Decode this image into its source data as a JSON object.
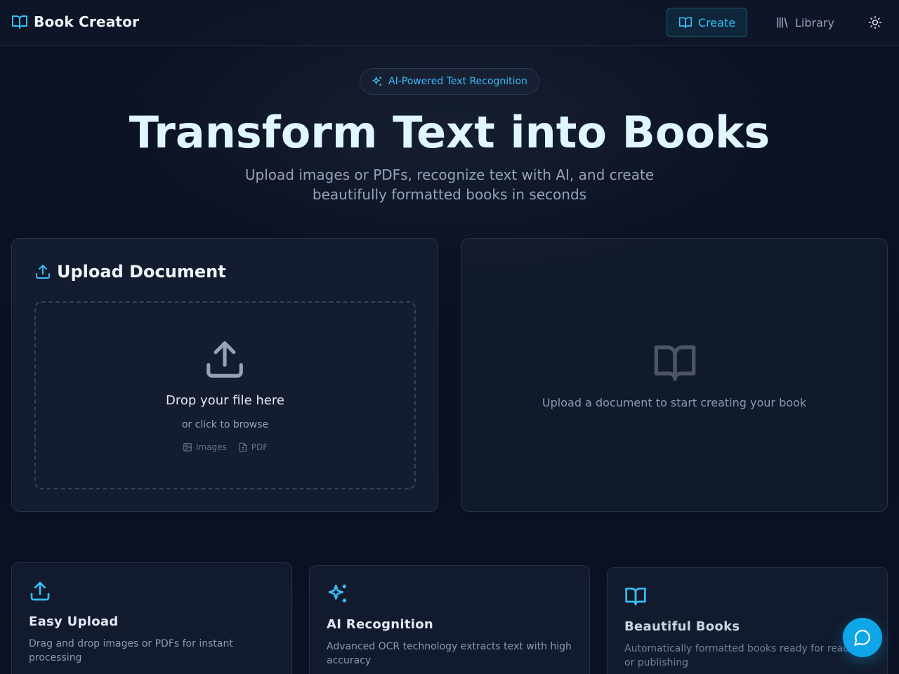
{
  "nav": {
    "brand": "Book Creator",
    "create_label": "Create",
    "library_label": "Library",
    "theme_icon": "sun-icon"
  },
  "hero": {
    "badge": "AI-Powered Text Recognition",
    "title": "Transform Text into Books",
    "subtitle": "Upload images or PDFs, recognize text with AI, and create beautifully formatted books in seconds"
  },
  "upload": {
    "heading": "Upload Document",
    "drop_title": "Drop your file here",
    "drop_sub": "or click to browse",
    "types": [
      "Images",
      "PDF"
    ]
  },
  "preview": {
    "empty_text": "Upload a document to start creating your book"
  },
  "features": [
    {
      "icon": "upload-icon",
      "title": "Easy Upload",
      "desc": "Drag and drop images or PDFs for instant processing"
    },
    {
      "icon": "sparkles-icon",
      "title": "AI Recognition",
      "desc": "Advanced OCR technology extracts text with high accuracy"
    },
    {
      "icon": "book-open-icon",
      "title": "Beautiful Books",
      "desc": "Automatically formatted books ready for reading or publishing"
    }
  ],
  "colors": {
    "accent": "#38bdf8",
    "background": "#0b1121",
    "panel": "#161f32",
    "fab": "#0ea5e9"
  }
}
